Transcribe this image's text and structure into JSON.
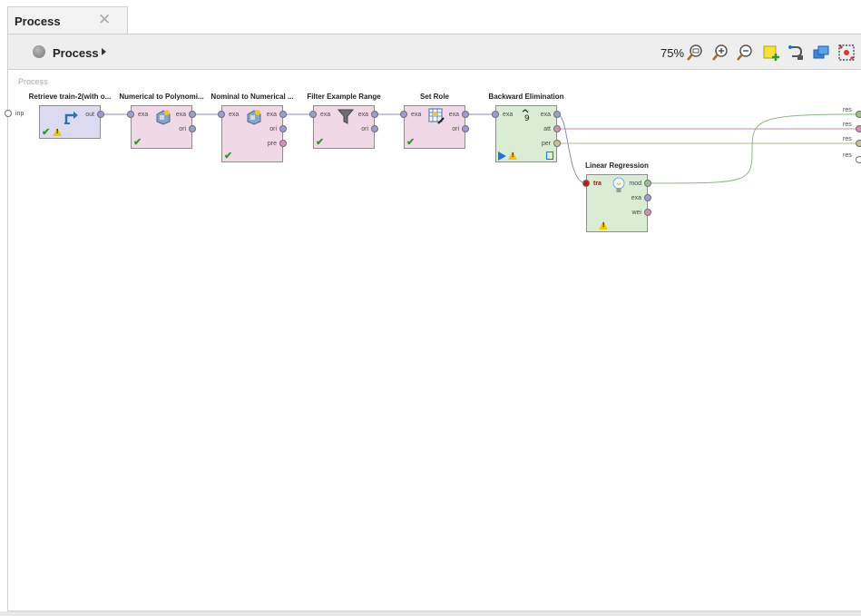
{
  "tab": {
    "label": "Process",
    "close": "✕"
  },
  "header": {
    "title": "Process",
    "zoom": "75%"
  },
  "toolbar": [
    {
      "name": "zoom-reset-icon"
    },
    {
      "name": "zoom-in-icon"
    },
    {
      "name": "zoom-out-icon"
    },
    {
      "name": "add-note-icon"
    },
    {
      "name": "auto-wire-icon"
    },
    {
      "name": "order-operators-icon"
    },
    {
      "name": "auto-layout-icon"
    }
  ],
  "canvas": {
    "label": "Process",
    "input_port": "inp",
    "result_ports": [
      "res",
      "res",
      "res",
      "res"
    ]
  },
  "operators": [
    {
      "id": "retrieve",
      "title": "Retrieve train-2(with o...",
      "color": "#dcdaf0",
      "inputs": [],
      "outputs": [
        {
          "label": "out",
          "color": "#9c9cd8"
        }
      ],
      "status": {
        "check": true,
        "warn": true
      }
    },
    {
      "id": "num2poly",
      "title": "Numerical to Polynomi...",
      "color": "#f1d8e6",
      "inputs": [
        {
          "label": "exa",
          "color": "#9c9cd8"
        }
      ],
      "outputs": [
        {
          "label": "exa",
          "color": "#9c9cd8"
        },
        {
          "label": "ori",
          "color": "#9c9cd8"
        }
      ],
      "status": {
        "check": true,
        "warn": false
      }
    },
    {
      "id": "nom2num",
      "title": "Nominal to Numerical ...",
      "color": "#f1d8e6",
      "inputs": [
        {
          "label": "exa",
          "color": "#9c9cd8"
        }
      ],
      "outputs": [
        {
          "label": "exa",
          "color": "#9c9cd8"
        },
        {
          "label": "ori",
          "color": "#9c9cd8"
        },
        {
          "label": "pre",
          "color": "#d88fb6"
        }
      ],
      "status": {
        "check": true,
        "warn": false
      }
    },
    {
      "id": "filter",
      "title": "Filter Example Range",
      "color": "#f1d8e6",
      "inputs": [
        {
          "label": "exa",
          "color": "#9c9cd8"
        }
      ],
      "outputs": [
        {
          "label": "exa",
          "color": "#9c9cd8"
        },
        {
          "label": "ori",
          "color": "#9c9cd8"
        }
      ],
      "status": {
        "check": true,
        "warn": false
      }
    },
    {
      "id": "setrole",
      "title": "Set Role",
      "color": "#f1d8e6",
      "inputs": [
        {
          "label": "exa",
          "color": "#9c9cd8"
        }
      ],
      "outputs": [
        {
          "label": "exa",
          "color": "#9c9cd8"
        },
        {
          "label": "ori",
          "color": "#9c9cd8"
        }
      ],
      "status": {
        "check": true,
        "warn": false
      }
    },
    {
      "id": "backelim",
      "title": "Backward Elimination",
      "color": "#daecd4",
      "inputs": [
        {
          "label": "exa",
          "color": "#9c9cd8"
        }
      ],
      "outputs": [
        {
          "label": "exa",
          "color": "#9c9cd8"
        },
        {
          "label": "att",
          "color": "#d88fb6"
        },
        {
          "label": "per",
          "color": "#c7c29a"
        }
      ],
      "status": {
        "check": false,
        "warn": true,
        "play": true
      }
    },
    {
      "id": "linreg",
      "title": "Linear Regression",
      "color": "#daecd4",
      "inputs": [
        {
          "label": "tra",
          "color": "#c01818"
        }
      ],
      "outputs": [
        {
          "label": "mod",
          "color": "#9bbf90"
        },
        {
          "label": "exa",
          "color": "#9c9cd8"
        },
        {
          "label": "wei",
          "color": "#d88fb6"
        }
      ],
      "status": {
        "check": false,
        "warn": true
      }
    }
  ]
}
